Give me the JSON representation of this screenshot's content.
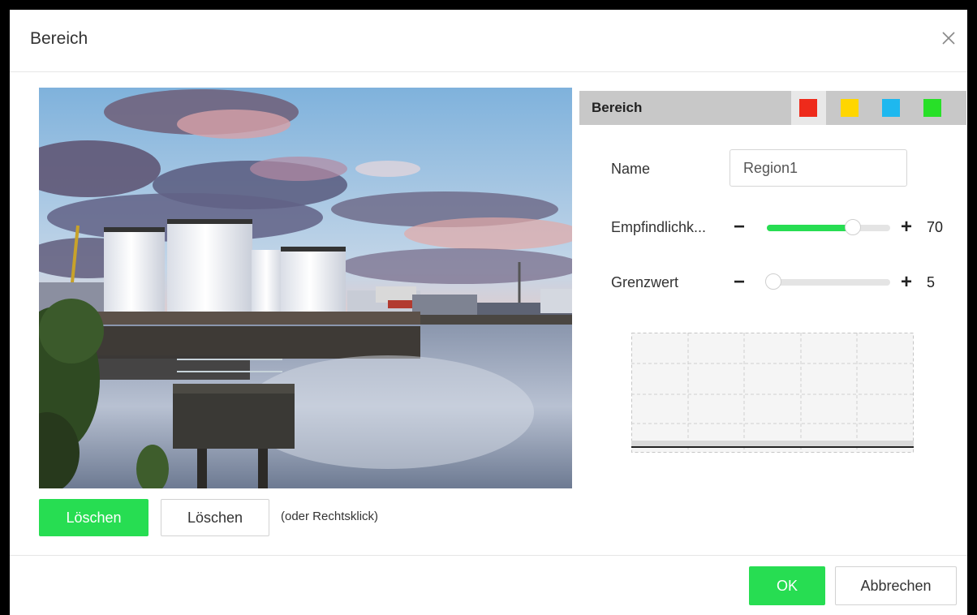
{
  "dialog": {
    "title": "Bereich"
  },
  "preview_actions": {
    "delete_primary_label": "Löschen",
    "delete_secondary_label": "Löschen",
    "hint": "(oder Rechtsklick)"
  },
  "region": {
    "label": "Bereich",
    "colors": [
      "#ee2a1b",
      "#ffd600",
      "#1eb8ef",
      "#28e028"
    ],
    "selected_color_index": 0
  },
  "form": {
    "name_label": "Name",
    "name_value": "Region1",
    "sensitivity_label": "Empfindlichk...",
    "sensitivity_value": 70,
    "sensitivity_display": "70",
    "threshold_label": "Grenzwert",
    "threshold_value": 5,
    "threshold_display": "5",
    "minus": "−",
    "plus": "+"
  },
  "footer": {
    "ok_label": "OK",
    "cancel_label": "Abbrechen"
  },
  "colors": {
    "accent": "#27dd52"
  },
  "icons": {
    "close": "close-icon"
  }
}
